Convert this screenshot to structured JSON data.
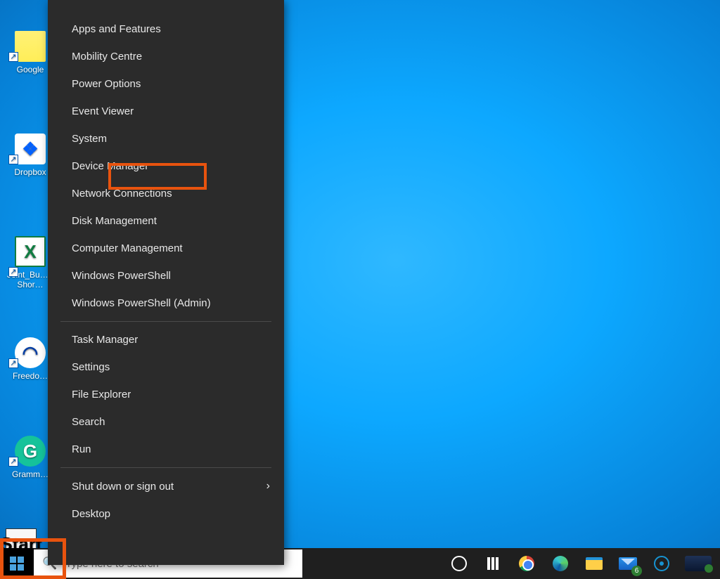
{
  "desktop": {
    "icons": {
      "google": {
        "label": "Google",
        "tile_text": ""
      },
      "dropbox": {
        "label": "Dropbox",
        "tile_text": "❖"
      },
      "excel": {
        "label": "Joint_Bu… - Shor…",
        "tile_text": "X"
      },
      "freedome": {
        "label": "Freedo…",
        "tile_text": "◠"
      },
      "grammarly": {
        "label": "Gramm…",
        "tile_text": "G"
      },
      "start": {
        "label": "Start"
      }
    }
  },
  "winx": {
    "items_a": [
      "Apps and Features",
      "Mobility Centre",
      "Power Options",
      "Event Viewer",
      "System",
      "Device Manager",
      "Network Connections",
      "Disk Management",
      "Computer Management",
      "Windows PowerShell",
      "Windows PowerShell (Admin)"
    ],
    "items_b": [
      "Task Manager",
      "Settings",
      "File Explorer",
      "Search",
      "Run"
    ],
    "items_c": [
      {
        "label": "Shut down or sign out",
        "submenu": true
      },
      {
        "label": "Desktop",
        "submenu": false
      }
    ],
    "highlighted_index": 5
  },
  "taskbar": {
    "search_placeholder": "Type here to search",
    "mail_badge": "6"
  }
}
